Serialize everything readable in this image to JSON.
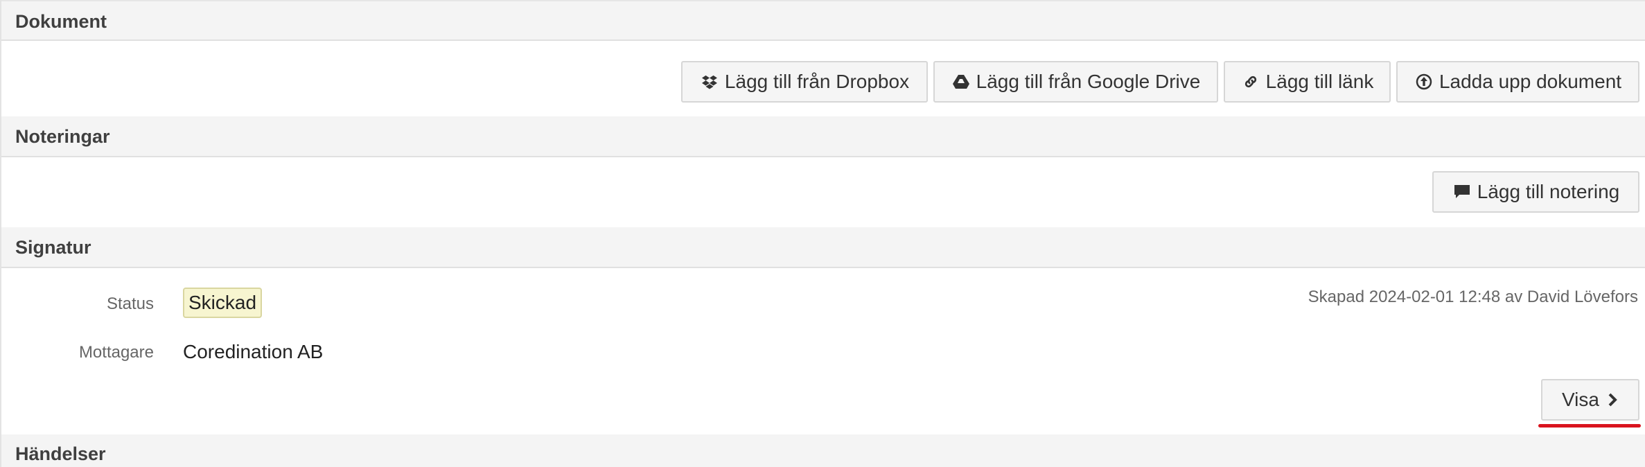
{
  "sections": {
    "dokument": {
      "title": "Dokument",
      "buttons": {
        "dropbox": "Lägg till från Dropbox",
        "google_drive": "Lägg till från Google Drive",
        "link": "Lägg till länk",
        "upload": "Ladda upp dokument"
      }
    },
    "noteringar": {
      "title": "Noteringar",
      "buttons": {
        "add_note": "Lägg till notering"
      }
    },
    "signatur": {
      "title": "Signatur",
      "status_label": "Status",
      "status_value": "Skickad",
      "recipient_label": "Mottagare",
      "recipient_value": "Coredination AB",
      "created_meta": "Skapad 2024-02-01 12:48 av David Lövefors",
      "show_button": "Visa"
    },
    "handelser": {
      "title": "Händelser"
    }
  },
  "icons": {
    "dropbox": "dropbox-icon",
    "google_drive": "google-drive-icon",
    "link": "link-icon",
    "upload": "upload-icon",
    "comment": "comment-icon",
    "chevron": "chevron-right-icon"
  },
  "colors": {
    "header_bg": "#f4f4f4",
    "badge_bg": "#f7f5d0",
    "highlight_underline": "#d9141e"
  }
}
